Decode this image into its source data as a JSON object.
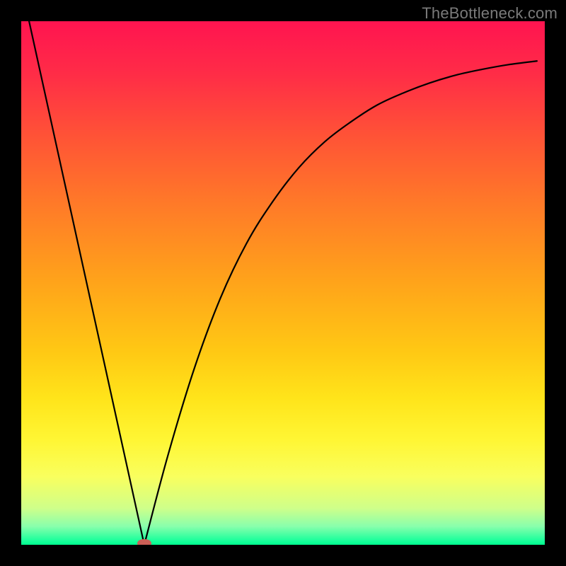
{
  "watermark": "TheBottleneck.com",
  "gradient": {
    "stops": [
      {
        "offset": 0.0,
        "color": "#ff1450"
      },
      {
        "offset": 0.1,
        "color": "#ff2c47"
      },
      {
        "offset": 0.22,
        "color": "#ff5336"
      },
      {
        "offset": 0.35,
        "color": "#ff7a28"
      },
      {
        "offset": 0.5,
        "color": "#ffa41a"
      },
      {
        "offset": 0.63,
        "color": "#ffc814"
      },
      {
        "offset": 0.72,
        "color": "#ffe41a"
      },
      {
        "offset": 0.8,
        "color": "#fff634"
      },
      {
        "offset": 0.87,
        "color": "#f9ff5e"
      },
      {
        "offset": 0.93,
        "color": "#cfff8a"
      },
      {
        "offset": 0.965,
        "color": "#88ffac"
      },
      {
        "offset": 0.99,
        "color": "#22ff9d"
      },
      {
        "offset": 1.0,
        "color": "#00ff90"
      }
    ]
  },
  "chart_data": {
    "type": "line",
    "title": "",
    "xlabel": "",
    "ylabel": "",
    "x_range": [
      0,
      1
    ],
    "y_range": [
      0,
      1
    ],
    "minimum_x": 0.235,
    "marker": {
      "x": 0.235,
      "y": 0.0,
      "color": "#cb5f56"
    },
    "series": [
      {
        "name": "bottleneck-curve",
        "segment": "left",
        "x": [
          0.015,
          0.235
        ],
        "y": [
          1.0,
          0.0
        ]
      },
      {
        "name": "bottleneck-curve",
        "segment": "right",
        "x": [
          0.235,
          0.28,
          0.33,
          0.38,
          0.43,
          0.48,
          0.53,
          0.58,
          0.63,
          0.68,
          0.73,
          0.78,
          0.83,
          0.88,
          0.93,
          0.985
        ],
        "y": [
          0.0,
          0.17,
          0.335,
          0.47,
          0.575,
          0.655,
          0.72,
          0.77,
          0.808,
          0.84,
          0.863,
          0.882,
          0.897,
          0.908,
          0.917,
          0.924
        ]
      }
    ]
  }
}
